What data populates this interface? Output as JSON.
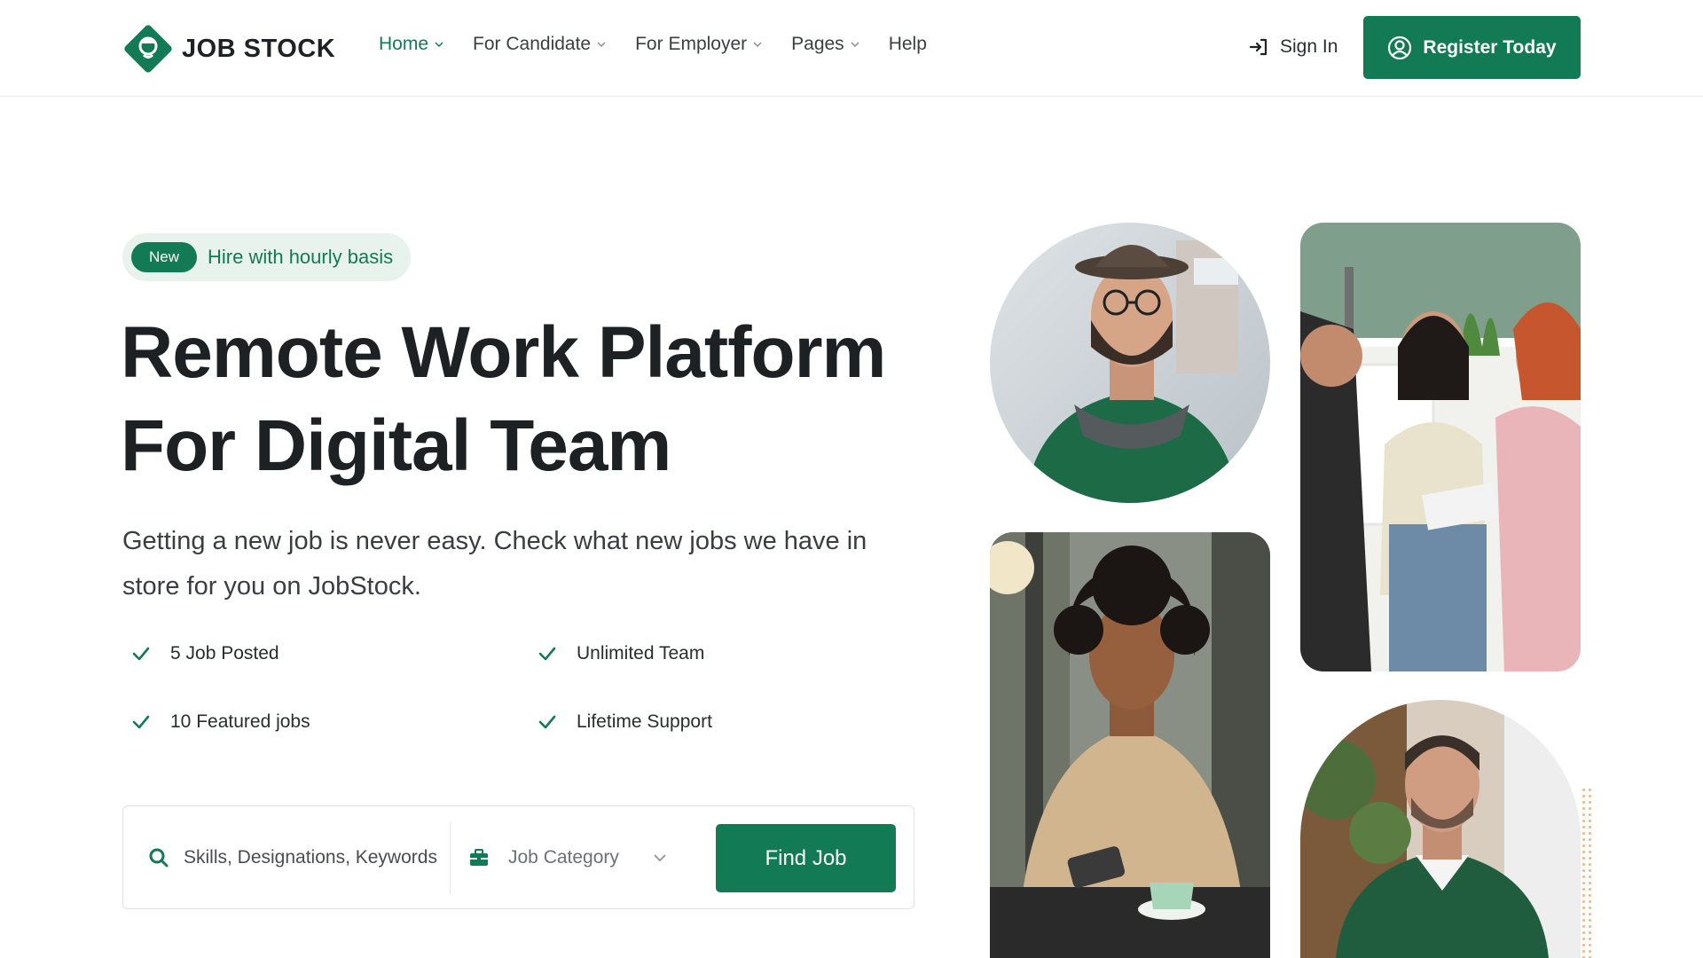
{
  "brand": {
    "name": "JOB STOCK",
    "accent_color": "#127a55",
    "logo_icon": "shield-badge-icon"
  },
  "nav": {
    "items": [
      {
        "label": "Home",
        "has_dropdown": true,
        "active": true
      },
      {
        "label": "For Candidate",
        "has_dropdown": true,
        "active": false
      },
      {
        "label": "For Employer",
        "has_dropdown": true,
        "active": false
      },
      {
        "label": "Pages",
        "has_dropdown": true,
        "active": false
      },
      {
        "label": "Help",
        "has_dropdown": false,
        "active": false
      }
    ],
    "signin_label": "Sign In",
    "signin_icon": "sign-in-icon",
    "register_label": "Register Today",
    "register_icon": "user-circle-icon"
  },
  "hero": {
    "badge_pill": "New",
    "badge_text": "Hire with hourly basis",
    "title_line1": "Remote Work Platform",
    "title_line2": "For Digital Team",
    "subtitle": "Getting a new job is never easy. Check what new jobs we have in store for you on JobStock.",
    "features": [
      "5 Job Posted",
      "Unlimited Team",
      "10 Featured jobs",
      "Lifetime Support"
    ]
  },
  "search": {
    "placeholder": "Skills, Designations, Keywords",
    "category_label": "Job Category",
    "button_label": "Find Job"
  },
  "photos": [
    {
      "name": "man-with-hat-photo"
    },
    {
      "name": "team-meeting-photo"
    },
    {
      "name": "woman-with-phone-photo"
    },
    {
      "name": "man-looking-up-photo"
    }
  ]
}
